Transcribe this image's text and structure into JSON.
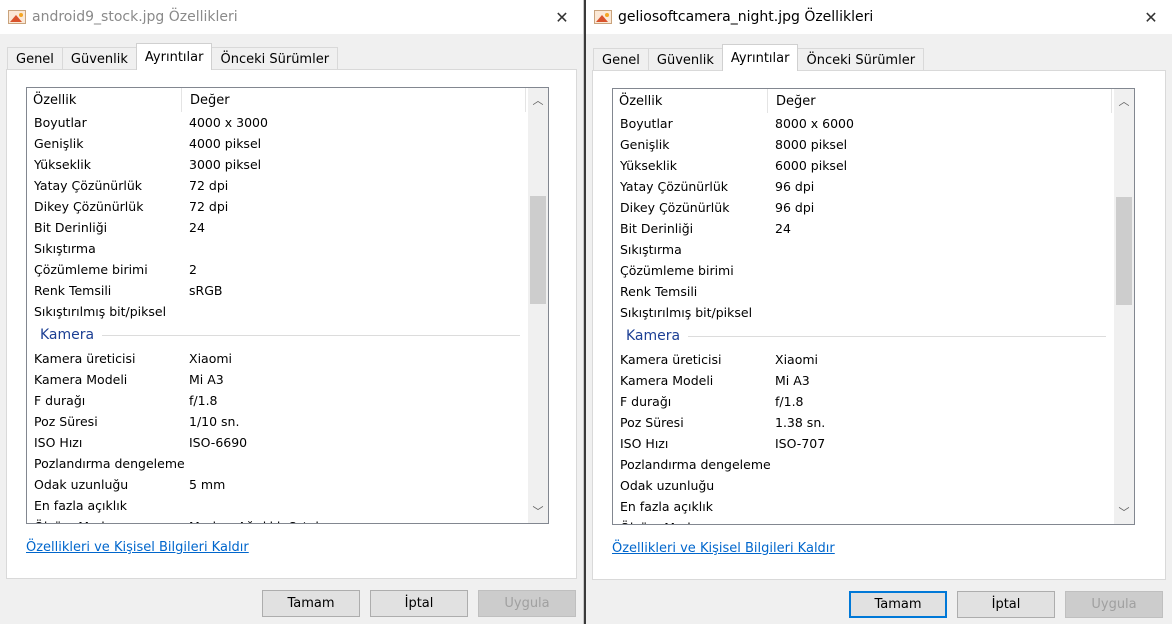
{
  "left": {
    "title": "android9_stock.jpg Özellikleri",
    "tabs": [
      "Genel",
      "Güvenlik",
      "Ayrıntılar",
      "Önceki Sürümler"
    ],
    "header": {
      "prop": "Özellik",
      "val": "Değer"
    },
    "rows": [
      {
        "k": "Boyutlar",
        "v": "4000 x 3000"
      },
      {
        "k": "Genişlik",
        "v": "4000 piksel"
      },
      {
        "k": "Yükseklik",
        "v": "3000 piksel"
      },
      {
        "k": "Yatay Çözünürlük",
        "v": "72 dpi"
      },
      {
        "k": "Dikey Çözünürlük",
        "v": "72 dpi"
      },
      {
        "k": "Bit Derinliği",
        "v": "24"
      },
      {
        "k": "Sıkıştırma",
        "v": ""
      },
      {
        "k": "Çözümleme birimi",
        "v": "2"
      },
      {
        "k": "Renk Temsili",
        "v": "sRGB"
      },
      {
        "k": "Sıkıştırılmış bit/piksel",
        "v": ""
      }
    ],
    "group": "Kamera",
    "camera_rows": [
      {
        "k": "Kamera üreticisi",
        "v": "Xiaomi"
      },
      {
        "k": "Kamera Modeli",
        "v": "Mi A3"
      },
      {
        "k": "F durağı",
        "v": "f/1.8"
      },
      {
        "k": "Poz Süresi",
        "v": "1/10 sn."
      },
      {
        "k": "ISO Hızı",
        "v": "ISO-6690"
      },
      {
        "k": "Pozlandırma dengeleme",
        "v": ""
      },
      {
        "k": "Odak uzunluğu",
        "v": "5 mm"
      },
      {
        "k": "En fazla açıklık",
        "v": ""
      },
      {
        "k": "Ölçüm Modu",
        "v": "Merkez Ağırlıklı Ortalama"
      }
    ],
    "link": "Özellikleri ve Kişisel Bilgileri Kaldır",
    "buttons": {
      "ok": "Tamam",
      "cancel": "İptal",
      "apply": "Uygula"
    }
  },
  "right": {
    "title": "geliosoftcamera_night.jpg Özellikleri",
    "tabs": [
      "Genel",
      "Güvenlik",
      "Ayrıntılar",
      "Önceki Sürümler"
    ],
    "header": {
      "prop": "Özellik",
      "val": "Değer"
    },
    "rows": [
      {
        "k": "Boyutlar",
        "v": "8000 x 6000"
      },
      {
        "k": "Genişlik",
        "v": "8000 piksel"
      },
      {
        "k": "Yükseklik",
        "v": "6000 piksel"
      },
      {
        "k": "Yatay Çözünürlük",
        "v": "96 dpi"
      },
      {
        "k": "Dikey Çözünürlük",
        "v": "96 dpi"
      },
      {
        "k": "Bit Derinliği",
        "v": "24"
      },
      {
        "k": "Sıkıştırma",
        "v": ""
      },
      {
        "k": "Çözümleme birimi",
        "v": ""
      },
      {
        "k": "Renk Temsili",
        "v": ""
      },
      {
        "k": "Sıkıştırılmış bit/piksel",
        "v": ""
      }
    ],
    "group": "Kamera",
    "camera_rows": [
      {
        "k": "Kamera üreticisi",
        "v": "Xiaomi"
      },
      {
        "k": "Kamera Modeli",
        "v": "Mi A3"
      },
      {
        "k": "F durağı",
        "v": "f/1.8"
      },
      {
        "k": "Poz Süresi",
        "v": "1.38 sn."
      },
      {
        "k": "ISO Hızı",
        "v": "ISO-707"
      },
      {
        "k": "Pozlandırma dengeleme",
        "v": ""
      },
      {
        "k": "Odak uzunluğu",
        "v": ""
      },
      {
        "k": "En fazla açıklık",
        "v": ""
      },
      {
        "k": "Ölçüm Modu",
        "v": ""
      }
    ],
    "link": "Özellikleri ve Kişisel Bilgileri Kaldır",
    "buttons": {
      "ok": "Tamam",
      "cancel": "İptal",
      "apply": "Uygula"
    }
  },
  "icons": {
    "close": "close-icon",
    "file": "image-file-icon",
    "scroll_up": "chevron-up-icon",
    "scroll_down": "chevron-down-icon"
  }
}
